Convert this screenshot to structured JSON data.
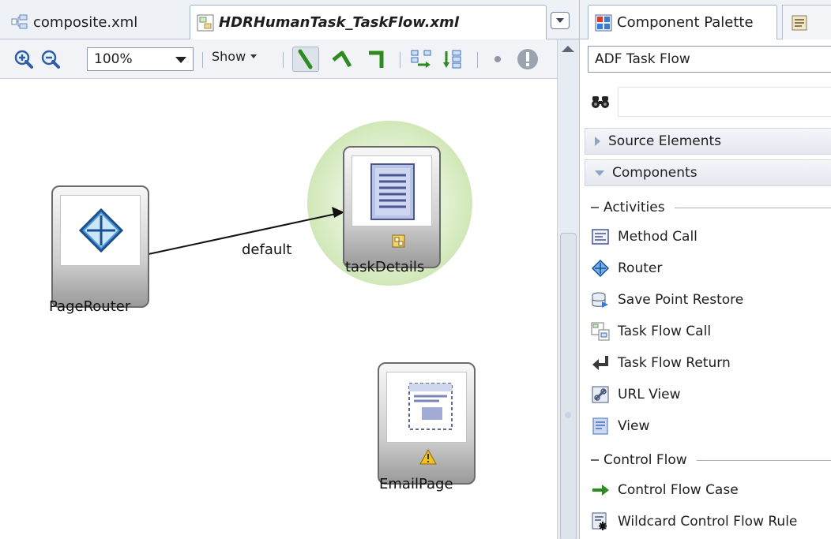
{
  "editor": {
    "tabs": [
      {
        "label": "composite.xml",
        "icon": "composite-icon"
      },
      {
        "label": "HDRHumanTask_TaskFlow.xml",
        "icon": "taskflow-file-icon"
      }
    ],
    "toolbar": {
      "zoom_value": "100%",
      "show_label": "Show"
    },
    "diagram": {
      "nodes": [
        {
          "label": "PageRouter",
          "icon": "router-icon"
        },
        {
          "label": "taskDetails",
          "icon": "view-icon"
        },
        {
          "label": "EmailPage",
          "icon": "page-icon"
        }
      ],
      "edge_label": "default"
    }
  },
  "palette": {
    "tab_label": "Component Palette",
    "select_value": "ADF Task Flow",
    "search_value": "",
    "sections": {
      "source_elements": "Source Elements",
      "components": "Components"
    },
    "groups": {
      "activities": "Activities",
      "control_flow": "Control Flow"
    },
    "activities": [
      {
        "label": "Method Call",
        "icon": "method-call-icon"
      },
      {
        "label": "Router",
        "icon": "router-icon"
      },
      {
        "label": "Save Point Restore",
        "icon": "save-point-restore-icon"
      },
      {
        "label": "Task Flow Call",
        "icon": "task-flow-call-icon"
      },
      {
        "label": "Task Flow Return",
        "icon": "task-flow-return-icon"
      },
      {
        "label": "URL View",
        "icon": "url-view-icon"
      },
      {
        "label": "View",
        "icon": "view-icon"
      }
    ],
    "control_flow": [
      {
        "label": "Control Flow Case",
        "icon": "control-flow-case-icon"
      },
      {
        "label": "Wildcard Control Flow Rule",
        "icon": "wildcard-rule-icon"
      }
    ]
  },
  "colors": {
    "accent": "#3f6fb5",
    "halo": "#cfe7b6",
    "green_tool": "#2e8b1f"
  }
}
